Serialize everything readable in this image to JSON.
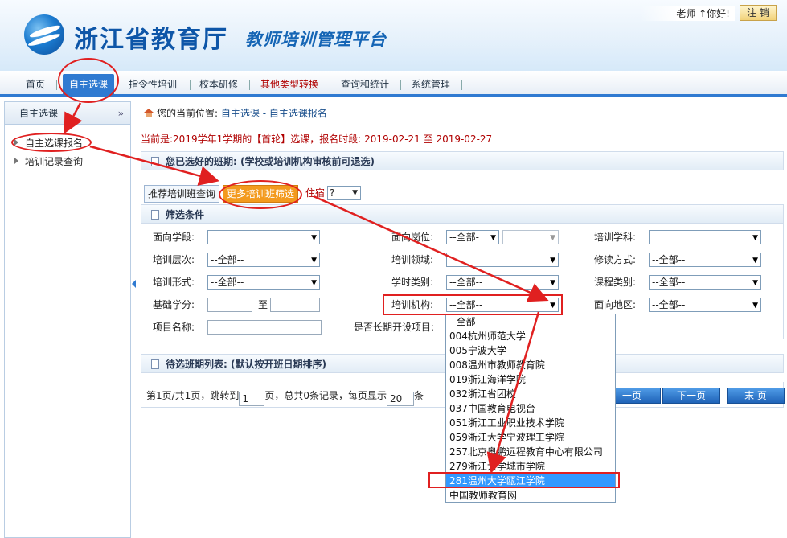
{
  "header": {
    "title": "浙江省教育厅",
    "subtitle": "教师培训管理平台",
    "user_greeting": "老师 ↑你好!",
    "logout_label": "注 销"
  },
  "nav": {
    "items": [
      "首页",
      "自主选课",
      "指令性培训",
      "校本研修",
      "其他类型转换",
      "查询和统计",
      "系统管理"
    ],
    "active": "自主选课"
  },
  "sidebar": {
    "title": "自主选课",
    "collapse_icon": "double-chevron-down-icon",
    "items": [
      "自主选课报名",
      "培训记录查询"
    ]
  },
  "breadcrumb": {
    "prefix": "您的当前位置:",
    "path": "自主选课 - 自主选课报名"
  },
  "notice": {
    "text": "当前是:2019学年1学期的【首轮】选课，报名时段: 2019-02-21 至 2019-02-27"
  },
  "selected_panel": {
    "title": "您已选好的班期: (学校或培训机构审核前可退选)"
  },
  "tabs": {
    "items": [
      "推荐培训班查询",
      "更多培训班筛选"
    ],
    "lodging_label": "住宿",
    "lodging_value": "?"
  },
  "filter": {
    "title": "筛选条件",
    "fields": {
      "grade_label": "面向学段:",
      "grade_value": "",
      "position_label": "面向岗位:",
      "position_value": "--全部-",
      "position2_value": "",
      "subject_label": "培训学科:",
      "subject_value": "",
      "level_label": "培训层次:",
      "level_value": "--全部--",
      "domain_label": "培训领域:",
      "domain_value": "",
      "study_label": "修读方式:",
      "study_value": "--全部--",
      "form_label": "培训形式:",
      "form_value": "--全部--",
      "hour_label": "学时类别:",
      "hour_value": "--全部--",
      "course_label": "课程类别:",
      "course_value": "--全部--",
      "credit_label": "基础学分:",
      "credit_to": "至",
      "org_label": "培训机构:",
      "org_value": "--全部--",
      "region_label": "面向地区:",
      "region_value": "--全部--",
      "project_label": "项目名称:",
      "longterm_label": "是否长期开设项目:"
    }
  },
  "pending_panel": {
    "title": "待选班期列表: (默认按开班日期排序)"
  },
  "pager": {
    "text_before": "第1页/共1页，跳转到",
    "page_input": "1",
    "text_mid": "页，总共0条记录，每页显示",
    "page_size": "20",
    "text_after": "条",
    "prev_label": "一页",
    "next_label": "下一页",
    "last_label": "末 页"
  },
  "org_dropdown": {
    "options": [
      "--全部--",
      "004杭州师范大学",
      "005宁波大学",
      "008温州市教师教育院",
      "019浙江海洋学院",
      "032浙江省团校",
      "037中国教育电视台",
      "051浙江工业职业技术学院",
      "059浙江大学宁波理工学院",
      "257北京奥鹏远程教育中心有限公司",
      "279浙江大学城市学院",
      "281温州大学瓯江学院",
      "中国教师教育网"
    ],
    "selected": "281温州大学瓯江学院"
  },
  "colors": {
    "accent": "#2f7ad1",
    "annotation": "#e02020",
    "notice": "#b00000",
    "highlight_tab": "#f39a1e"
  }
}
